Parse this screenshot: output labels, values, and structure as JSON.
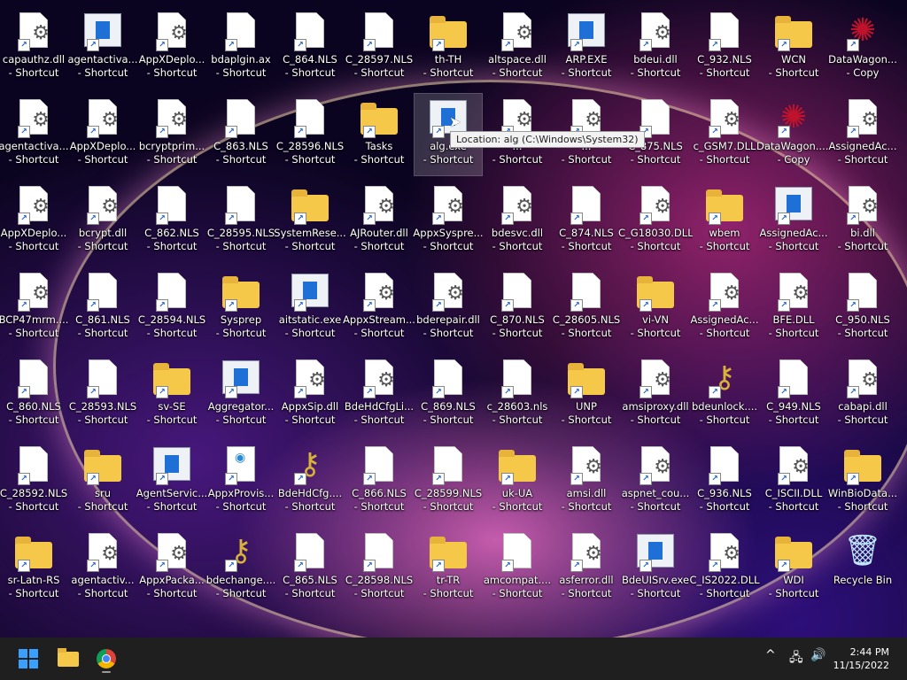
{
  "desktop": {
    "icons": [
      {
        "label": "capauthz.dll - Shortcut",
        "kind": "dll",
        "icon": "gear-doc-icon"
      },
      {
        "label": "agentactiva... - Shortcut",
        "kind": "win",
        "icon": "window-app-icon"
      },
      {
        "label": "AppXDeplo... - Shortcut",
        "kind": "dll",
        "icon": "gear-doc-icon"
      },
      {
        "label": "bdaplgin.ax - Shortcut",
        "kind": "page",
        "icon": "blank-file-icon"
      },
      {
        "label": "C_864.NLS - Shortcut",
        "kind": "page",
        "icon": "blank-file-icon"
      },
      {
        "label": "C_28597.NLS - Shortcut",
        "kind": "page",
        "icon": "blank-file-icon"
      },
      {
        "label": "th-TH - Shortcut",
        "kind": "folder",
        "icon": "folder-icon"
      },
      {
        "label": "altspace.dll - Shortcut",
        "kind": "dll",
        "icon": "gear-doc-icon"
      },
      {
        "label": "ARP.EXE - Shortcut",
        "kind": "win",
        "icon": "window-app-icon"
      },
      {
        "label": "bdeui.dll - Shortcut",
        "kind": "dll",
        "icon": "gear-doc-icon"
      },
      {
        "label": "C_932.NLS - Shortcut",
        "kind": "page",
        "icon": "blank-file-icon"
      },
      {
        "label": "WCN - Shortcut",
        "kind": "folder",
        "icon": "folder-icon"
      },
      {
        "label": "DataWagon... - Copy",
        "kind": "flower",
        "icon": "datawagon-icon"
      },
      {
        "label": "agentactiva... - Shortcut",
        "kind": "dll",
        "icon": "gear-doc-icon"
      },
      {
        "label": "AppXDeplo... - Shortcut",
        "kind": "dll",
        "icon": "gear-doc-icon"
      },
      {
        "label": "bcryptprim... - Shortcut",
        "kind": "dll",
        "icon": "gear-doc-icon"
      },
      {
        "label": "C_863.NLS - Shortcut",
        "kind": "page",
        "icon": "blank-file-icon"
      },
      {
        "label": "C_28596.NLS - Shortcut",
        "kind": "page",
        "icon": "blank-file-icon"
      },
      {
        "label": "Tasks - Shortcut",
        "kind": "folder",
        "icon": "folder-icon"
      },
      {
        "label": "alg.exe - Shortcut",
        "kind": "win",
        "icon": "window-app-icon",
        "selected": true
      },
      {
        "label": "... - Shortcut",
        "kind": "dll",
        "icon": "gear-doc-icon"
      },
      {
        "label": "... - Shortcut",
        "kind": "dll",
        "icon": "gear-doc-icon"
      },
      {
        "label": "C_875.NLS - Shortcut",
        "kind": "page",
        "icon": "blank-file-icon"
      },
      {
        "label": "c_GSM7.DLL - Shortcut",
        "kind": "dll",
        "icon": "gear-doc-icon"
      },
      {
        "label": "DataWagon.... (2) - Copy",
        "kind": "flower",
        "icon": "datawagon-icon"
      },
      {
        "label": "AssignedAc... - Shortcut",
        "kind": "dll",
        "icon": "gear-doc-icon"
      },
      {
        "label": "AppXDeplo... - Shortcut",
        "kind": "dll",
        "icon": "gear-doc-icon"
      },
      {
        "label": "bcrypt.dll - Shortcut",
        "kind": "dll",
        "icon": "gear-doc-icon"
      },
      {
        "label": "C_862.NLS - Shortcut",
        "kind": "page",
        "icon": "blank-file-icon"
      },
      {
        "label": "C_28595.NLS - Shortcut",
        "kind": "page",
        "icon": "blank-file-icon"
      },
      {
        "label": "SystemRese... - Shortcut",
        "kind": "folder",
        "icon": "folder-icon"
      },
      {
        "label": "AJRouter.dll - Shortcut",
        "kind": "dll",
        "icon": "gear-doc-icon"
      },
      {
        "label": "AppxSyspre... - Shortcut",
        "kind": "dll",
        "icon": "gear-doc-icon"
      },
      {
        "label": "bdesvc.dll - Shortcut",
        "kind": "dll",
        "icon": "gear-doc-icon"
      },
      {
        "label": "C_874.NLS - Shortcut",
        "kind": "page",
        "icon": "blank-file-icon"
      },
      {
        "label": "C_G18030.DLL - Shortcut",
        "kind": "dll",
        "icon": "gear-doc-icon"
      },
      {
        "label": "wbem - Shortcut",
        "kind": "folder",
        "icon": "folder-icon"
      },
      {
        "label": "AssignedAc... - Shortcut",
        "kind": "win",
        "icon": "window-app-icon"
      },
      {
        "label": "bi.dll - Shortcut",
        "kind": "dll",
        "icon": "gear-doc-icon"
      },
      {
        "label": "BCP47mrm.... - Shortcut",
        "kind": "dll",
        "icon": "gear-doc-icon"
      },
      {
        "label": "C_861.NLS - Shortcut",
        "kind": "page",
        "icon": "blank-file-icon"
      },
      {
        "label": "C_28594.NLS - Shortcut",
        "kind": "page",
        "icon": "blank-file-icon"
      },
      {
        "label": "Sysprep - Shortcut",
        "kind": "folder",
        "icon": "folder-icon"
      },
      {
        "label": "aitstatic.exe - Shortcut",
        "kind": "win",
        "icon": "window-app-icon"
      },
      {
        "label": "AppxStream... - Shortcut",
        "kind": "dll",
        "icon": "gear-doc-icon"
      },
      {
        "label": "bderepair.dll - Shortcut",
        "kind": "dll",
        "icon": "gear-doc-icon"
      },
      {
        "label": "C_870.NLS - Shortcut",
        "kind": "page",
        "icon": "blank-file-icon"
      },
      {
        "label": "C_28605.NLS - Shortcut",
        "kind": "page",
        "icon": "blank-file-icon"
      },
      {
        "label": "vi-VN - Shortcut",
        "kind": "folder",
        "icon": "folder-icon"
      },
      {
        "label": "AssignedAc... - Shortcut",
        "kind": "dll",
        "icon": "gear-doc-icon"
      },
      {
        "label": "BFE.DLL - Shortcut",
        "kind": "dll",
        "icon": "gear-doc-icon"
      },
      {
        "label": "C_950.NLS - Shortcut",
        "kind": "page",
        "icon": "blank-file-icon"
      },
      {
        "label": "C_860.NLS - Shortcut",
        "kind": "page",
        "icon": "blank-file-icon"
      },
      {
        "label": "C_28593.NLS - Shortcut",
        "kind": "page",
        "icon": "blank-file-icon"
      },
      {
        "label": "sv-SE - Shortcut",
        "kind": "folder",
        "icon": "folder-icon"
      },
      {
        "label": "Aggregator... - Shortcut",
        "kind": "win",
        "icon": "window-app-icon"
      },
      {
        "label": "AppxSip.dll - Shortcut",
        "kind": "dll",
        "icon": "gear-doc-icon"
      },
      {
        "label": "BdeHdCfgLi... - Shortcut",
        "kind": "dll",
        "icon": "gear-doc-icon"
      },
      {
        "label": "C_869.NLS - Shortcut",
        "kind": "page",
        "icon": "blank-file-icon"
      },
      {
        "label": "c_28603.nls - Shortcut",
        "kind": "page",
        "icon": "blank-file-icon"
      },
      {
        "label": "UNP - Shortcut",
        "kind": "folder",
        "icon": "folder-icon"
      },
      {
        "label": "amsiproxy.dll - Shortcut",
        "kind": "dll",
        "icon": "gear-doc-icon"
      },
      {
        "label": "bdeunlock.... - Shortcut",
        "kind": "keys",
        "icon": "keys-icon"
      },
      {
        "label": "C_949.NLS - Shortcut",
        "kind": "page",
        "icon": "blank-file-icon"
      },
      {
        "label": "cabapi.dll - Shortcut",
        "kind": "dll",
        "icon": "gear-doc-icon"
      },
      {
        "label": "C_28592.NLS - Shortcut",
        "kind": "page",
        "icon": "blank-file-icon"
      },
      {
        "label": "sru - Shortcut",
        "kind": "folder",
        "icon": "folder-icon"
      },
      {
        "label": "AgentServic... - Shortcut",
        "kind": "win",
        "icon": "window-app-icon"
      },
      {
        "label": "AppxProvis... - Shortcut",
        "kind": "web",
        "icon": "web-doc-icon"
      },
      {
        "label": "BdeHdCfg.... - Shortcut",
        "kind": "keys",
        "icon": "keys-icon"
      },
      {
        "label": "C_866.NLS - Shortcut",
        "kind": "page",
        "icon": "blank-file-icon"
      },
      {
        "label": "C_28599.NLS - Shortcut",
        "kind": "page",
        "icon": "blank-file-icon"
      },
      {
        "label": "uk-UA - Shortcut",
        "kind": "folder",
        "icon": "folder-icon"
      },
      {
        "label": "amsi.dll - Shortcut",
        "kind": "dll",
        "icon": "gear-doc-icon"
      },
      {
        "label": "aspnet_cou... - Shortcut",
        "kind": "dll",
        "icon": "gear-doc-icon"
      },
      {
        "label": "C_936.NLS - Shortcut",
        "kind": "page",
        "icon": "blank-file-icon"
      },
      {
        "label": "C_ISCII.DLL - Shortcut",
        "kind": "dll",
        "icon": "gear-doc-icon"
      },
      {
        "label": "WinBioData... - Shortcut",
        "kind": "folder",
        "icon": "folder-icon"
      },
      {
        "label": "sr-Latn-RS - Shortcut",
        "kind": "folder",
        "icon": "folder-icon"
      },
      {
        "label": "agentactiv... - Shortcut",
        "kind": "dll",
        "icon": "gear-doc-icon"
      },
      {
        "label": "AppxPacka... - Shortcut",
        "kind": "dll",
        "icon": "gear-doc-icon"
      },
      {
        "label": "bdechange.... - Shortcut",
        "kind": "keys",
        "icon": "keys-icon"
      },
      {
        "label": "C_865.NLS - Shortcut",
        "kind": "page",
        "icon": "blank-file-icon"
      },
      {
        "label": "C_28598.NLS - Shortcut",
        "kind": "page",
        "icon": "blank-file-icon"
      },
      {
        "label": "tr-TR - Shortcut",
        "kind": "folder",
        "icon": "folder-icon"
      },
      {
        "label": "amcompat.... - Shortcut",
        "kind": "page",
        "icon": "blank-file-icon"
      },
      {
        "label": "asferror.dll - Shortcut",
        "kind": "dll",
        "icon": "gear-doc-icon"
      },
      {
        "label": "BdeUISrv.exe - Shortcut",
        "kind": "win",
        "icon": "window-app-icon"
      },
      {
        "label": "C_IS2022.DLL - Shortcut",
        "kind": "dll",
        "icon": "gear-doc-icon"
      },
      {
        "label": "WDI - Shortcut",
        "kind": "folder",
        "icon": "folder-icon"
      },
      {
        "label": "Recycle Bin",
        "kind": "bin",
        "icon": "recycle-bin-icon",
        "noarrow": true
      }
    ],
    "tooltip": "Location: alg (C:\\Windows\\System32)"
  },
  "taskbar": {
    "clock_time": "2:44 PM",
    "clock_date": "11/15/2022",
    "tray_icons": [
      "chevron-up-icon",
      "network-icon",
      "volume-icon"
    ]
  }
}
